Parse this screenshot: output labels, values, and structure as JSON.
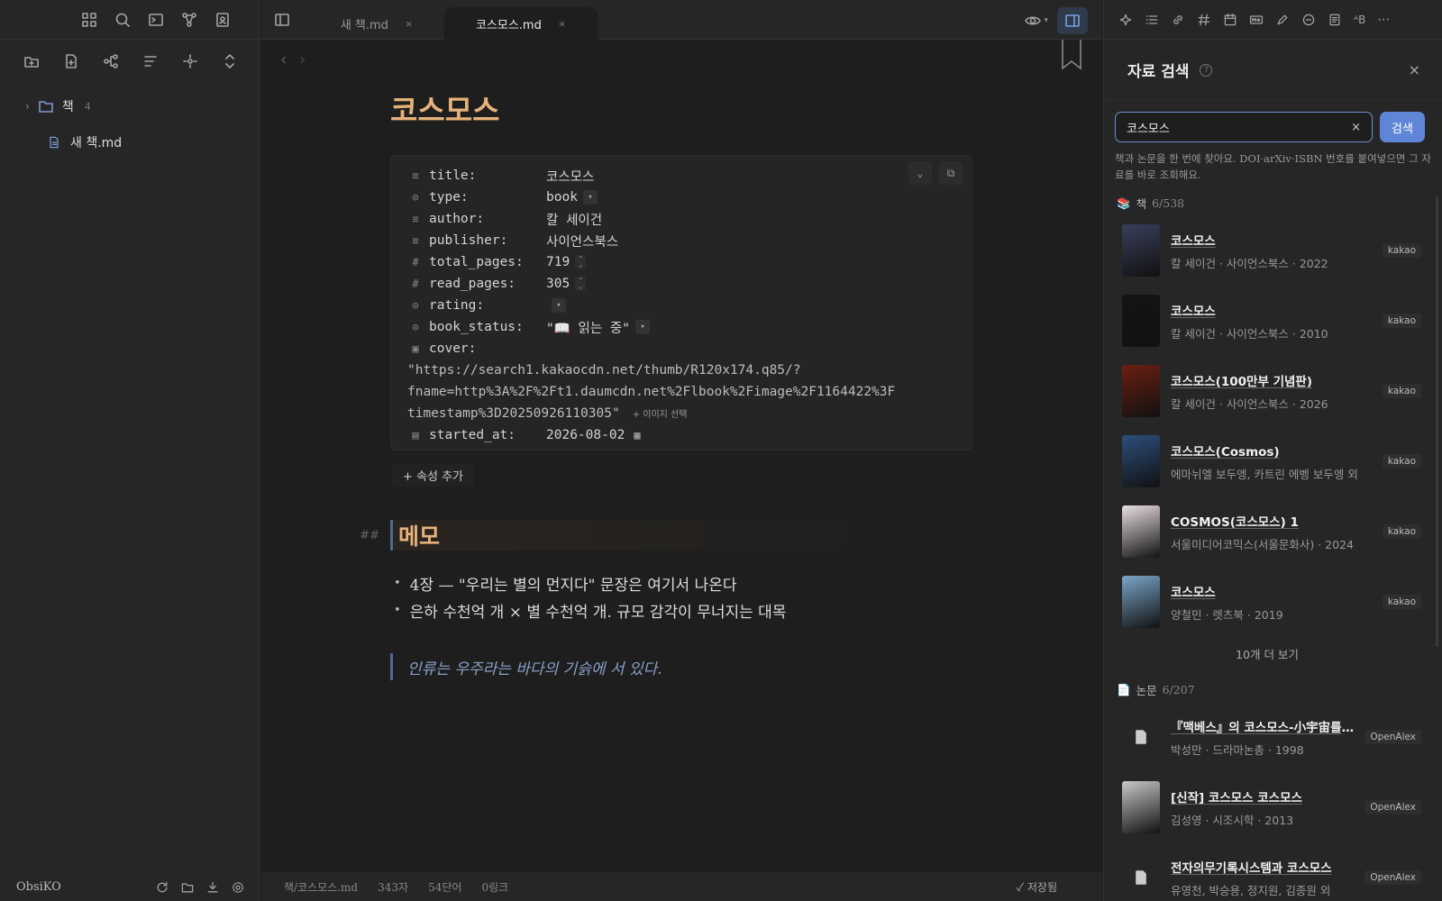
{
  "tabs": [
    {
      "label": "새 책.md",
      "close": "×"
    },
    {
      "label": "코스모스.md",
      "close": "×"
    }
  ],
  "sidebar": {
    "folder": {
      "label": "책",
      "count": "4"
    },
    "file": {
      "label": "새 책.md"
    },
    "footer": {
      "vault": "ObsiKO"
    }
  },
  "editor": {
    "title": "코스모스",
    "properties": [
      {
        "icon": "text-icon",
        "key": "title:",
        "value": "코스모스"
      },
      {
        "icon": "list-icon",
        "key": "type:",
        "value": "book"
      },
      {
        "icon": "text-icon",
        "key": "author:",
        "value": "칼 세이건"
      },
      {
        "icon": "text-icon",
        "key": "publisher:",
        "value": "사이언스북스"
      },
      {
        "icon": "number-icon",
        "key": "total_pages:",
        "value": "719"
      },
      {
        "icon": "number-icon",
        "key": "read_pages:",
        "value": "305"
      },
      {
        "icon": "list-icon",
        "key": "rating:",
        "value": ""
      },
      {
        "icon": "list-icon",
        "key": "book_status:",
        "value": "\"📖 읽는 중\""
      },
      {
        "icon": "image-icon",
        "key": "cover:",
        "value": ""
      },
      {
        "icon": "calendar-icon",
        "key": "started_at:",
        "value": "2026-08-02"
      }
    ],
    "cover_lines": [
      "\"https://search1.kakaocdn.net/thumb/R120x174.q85/?",
      "fname=http%3A%2F%2Ft1.daumcdn.net%2Flbook%2Fimage%2F1164422%3F",
      "timestamp%3D20250926110305\""
    ],
    "image_pick": "+ 이미지 선택",
    "add_property": "+ 속성 추가",
    "heading_mark": "##",
    "heading": "메모",
    "bullets": [
      "4장 — \"우리는 별의 먼지다\" 문장은 여기서 나온다",
      "은하 수천억 개 × 별 수천억 개. 규모 감각이 무너지는 대목"
    ],
    "quote": "인류는 우주라는 바다의 기슭에 서 있다."
  },
  "status": {
    "path": "책/코스모스.md",
    "chars": "343자",
    "words": "54단어",
    "links": "0링크",
    "saved": "✓ 저장됨"
  },
  "panel": {
    "title": "자료 검색",
    "help": "?",
    "close": "×",
    "query": "코스모스",
    "clear": "×",
    "search_button": "검색",
    "hint": "책과 논문을 한 번에 찾아요. DOI·arXiv·ISBN 번호를 붙여넣으면 그 자료를 바로 조회해요.",
    "books_section": {
      "label": "책",
      "count": "6/538"
    },
    "books": [
      {
        "title": "코스모스",
        "sub": "칼 세이건 · 사이언스북스 · 2022",
        "source": "kakao",
        "color": "#3a3f5c"
      },
      {
        "title": "코스모스",
        "sub": "칼 세이건 · 사이언스북스 · 2010",
        "source": "kakao",
        "color": "#141414"
      },
      {
        "title": "코스모스(100만부 기념판)",
        "sub": "칼 세이건 · 사이언스북스 · 2026",
        "source": "kakao",
        "color": "#6b1f12"
      },
      {
        "title": "코스모스(Cosmos)",
        "sub": "에마뉘엘 보두엥, 카트린 에벵 보두엥 외",
        "source": "kakao",
        "color": "#2c4f7c"
      },
      {
        "title": "COSMOS(코스모스) 1",
        "sub": "서울미디어코믹스(서울문화사) · 2024",
        "source": "kakao",
        "color": "#e9dfe3"
      },
      {
        "title": "코스모스",
        "sub": "양철민 · 렛츠북 · 2019",
        "source": "kakao",
        "color": "#7aa6c8"
      }
    ],
    "more": "10개 더 보기",
    "papers_section": {
      "label": "논문",
      "count": "6/207"
    },
    "papers": [
      {
        "title": "『맥베스』의 코스모스-小宇宙를 중심으로",
        "sub": "박성만 · 드라마논총 · 1998",
        "source": "OpenAlex",
        "cover": "doc"
      },
      {
        "title": "[신작] 코스모스 코스모스",
        "sub": "김성영 · 시조시학 · 2013",
        "source": "OpenAlex",
        "cover": "img"
      },
      {
        "title": "전자의무기록시스템과 코스모스",
        "sub": "유영천, 박승용, 정지원, 김종원 외",
        "source": "OpenAlex",
        "cover": "doc"
      }
    ]
  }
}
